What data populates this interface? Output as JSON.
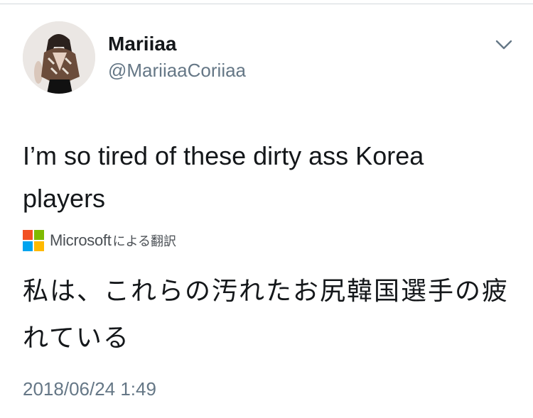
{
  "user": {
    "display_name": "Mariiaa",
    "handle": "@MariiaaCoriiaa"
  },
  "tweet": {
    "text": "I’m so tired of these dirty ass Korea players",
    "timestamp": "2018/06/24 1:49"
  },
  "translation": {
    "provider": "Microsoft",
    "credit_suffix": "による翻訳",
    "text": "私は、これらの汚れたお尻韓国選手の疲れている"
  },
  "icons": {
    "menu": "chevron-down-icon",
    "provider_logo": "microsoft-logo-icon"
  },
  "colors": {
    "text_primary": "#14171a",
    "text_secondary": "#657786",
    "ms_red": "#f25022",
    "ms_green": "#7fba00",
    "ms_blue": "#00a4ef",
    "ms_yellow": "#ffb900"
  }
}
